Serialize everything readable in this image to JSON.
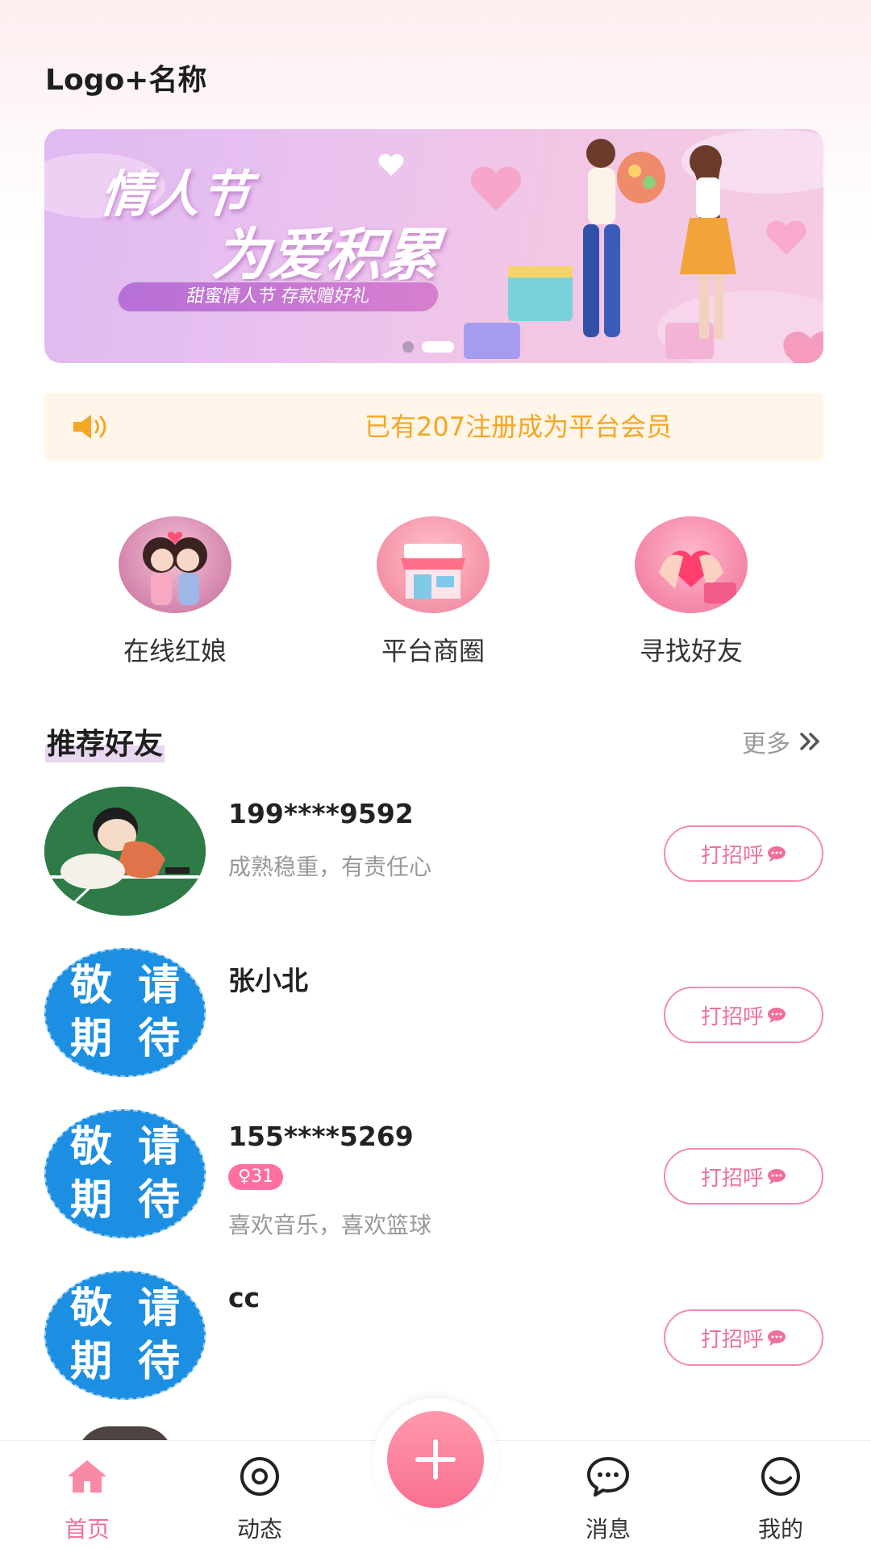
{
  "header": {
    "title": "Logo+名称"
  },
  "banner": {
    "line1": "情人节",
    "line2": "为爱积累",
    "subtitle": "甜蜜情人节 存款赠好礼",
    "slide_count": 2,
    "active_slide": 1
  },
  "notice": {
    "icon": "speaker-icon",
    "text": "已有207注册成为平台会员",
    "color": "#f5a623"
  },
  "quick_links": [
    {
      "label": "在线红娘",
      "icon": "matchmaker-couple-image"
    },
    {
      "label": "平台商圈",
      "icon": "shop-storefront-image"
    },
    {
      "label": "寻找好友",
      "icon": "heart-hands-image"
    }
  ],
  "recommend": {
    "title": "推荐好友",
    "more_label": "更多",
    "more_icon": "double-chevron-right-icon"
  },
  "friends": [
    {
      "name": "199****9592",
      "bio": "成熟稳重，有责任心",
      "tag": "",
      "avatar": "cartoon-boy-photo",
      "button": "打招呼"
    },
    {
      "name": "张小北",
      "bio": "",
      "tag": "",
      "avatar": "placeholder",
      "button": "打招呼"
    },
    {
      "name": "155****5269",
      "bio": "喜欢音乐，喜欢篮球",
      "tag": "♀31",
      "avatar": "placeholder",
      "button": "打招呼"
    },
    {
      "name": "cc",
      "bio": "",
      "tag": "",
      "avatar": "placeholder",
      "button": "打招呼"
    }
  ],
  "placeholder_avatar": {
    "chars": [
      "敬",
      "请",
      "期",
      "待"
    ],
    "color": "#1c8fe3"
  },
  "greet_icon": "chat-bubble-icon",
  "bottom_nav": {
    "items": [
      {
        "label": "首页",
        "icon": "home-icon",
        "active": true
      },
      {
        "label": "动态",
        "icon": "target-icon",
        "active": false
      },
      {
        "label": "消息",
        "icon": "message-icon",
        "active": false
      },
      {
        "label": "我的",
        "icon": "smile-icon",
        "active": false
      }
    ],
    "fab_icon": "plus-icon",
    "accent": "#f0709b"
  }
}
